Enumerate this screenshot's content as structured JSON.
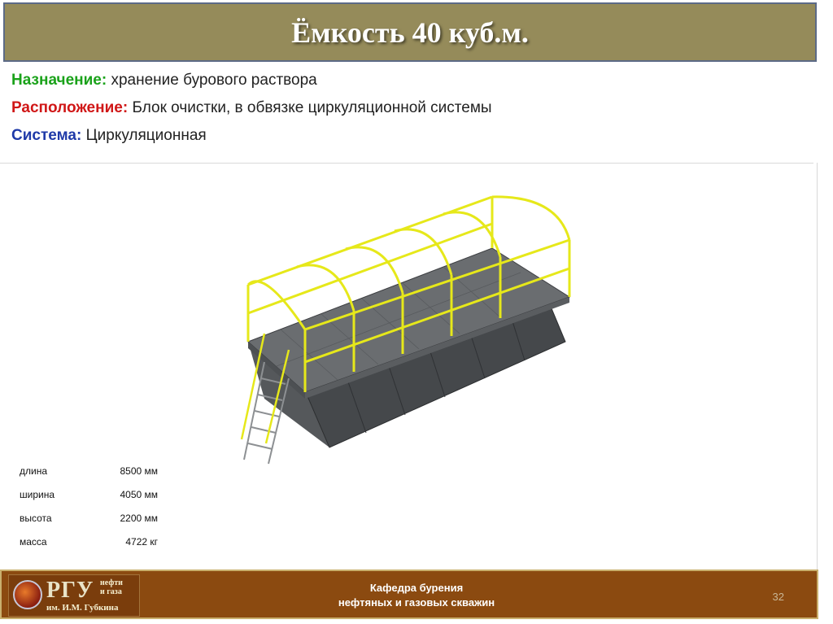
{
  "header": {
    "title": "Ёмкость 40 куб.м."
  },
  "info": {
    "purpose": {
      "label": "Назначение:",
      "value": "хранение бурового раствора",
      "color": "#1aa21a"
    },
    "location": {
      "label": "Расположение:",
      "value": "Блок очистки, в обвязке циркуляционной системы",
      "color": "#d01717"
    },
    "system": {
      "label": "Система:",
      "value": "Циркуляционная",
      "color": "#1f3aa8"
    }
  },
  "image": {
    "subject": "mud-tank-40m3",
    "accent_color": "#e6e81a",
    "body_color": "#4a4d50"
  },
  "specs": [
    {
      "name": "длина",
      "value": "8500 мм"
    },
    {
      "name": "ширина",
      "value": "4050 мм"
    },
    {
      "name": "высота",
      "value": "2200 мм"
    },
    {
      "name": "масса",
      "value": "4722 кг"
    }
  ],
  "footer": {
    "logo_big": "РГУ",
    "logo_small_1": "нефти",
    "logo_small_2": "и газа",
    "logo_line2": "им. И.М. Губкина",
    "dept_line1": "Кафедра бурения",
    "dept_line2": "нефтяных и газовых скважин",
    "page_number": "32",
    "bg_color": "#8b4a10"
  }
}
